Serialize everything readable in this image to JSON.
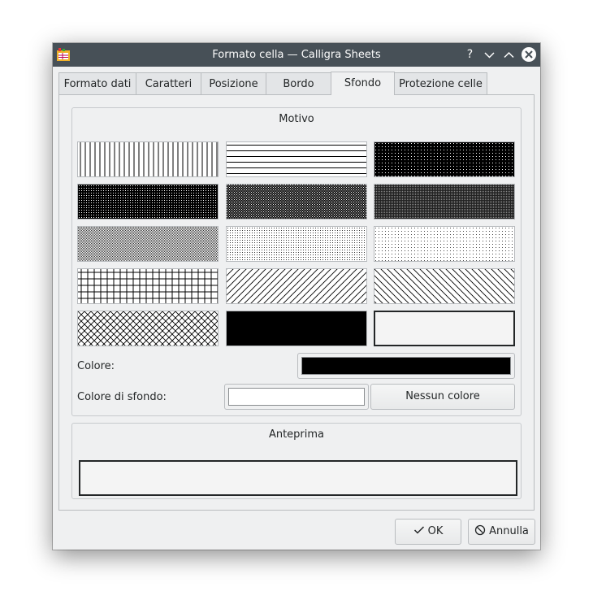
{
  "window": {
    "title": "Formato cella — Calligra Sheets",
    "help_glyph": "?",
    "minimize_glyph": "⌄",
    "maximize_glyph": "⌃",
    "close_glyph": "✕"
  },
  "tabs": [
    {
      "label": "Formato dati"
    },
    {
      "label": "Caratteri"
    },
    {
      "label": "Posizione"
    },
    {
      "label": "Bordo"
    },
    {
      "label": "Sfondo"
    },
    {
      "label": "Protezione celle"
    }
  ],
  "motivo": {
    "title": "Motivo",
    "patterns": [
      "vertical-lines",
      "horizontal-lines",
      "dense-dots-1",
      "dense-dots-2",
      "dense-dots-3",
      "dense-dots-4",
      "dense-dots-5",
      "dense-dots-6",
      "sparse-dots",
      "grid",
      "diagonal-bdiag",
      "diagonal-fdiag",
      "diagonal-cross",
      "solid",
      "no-brush"
    ],
    "color_label": "Colore:",
    "color_value": "#000000",
    "bg_label": "Colore di sfondo:",
    "bg_value": "#ffffff",
    "no_color_label": "Nessun colore"
  },
  "preview": {
    "title": "Anteprima"
  },
  "buttons": {
    "ok_label": "OK",
    "cancel_label": "Annulla"
  },
  "colors": {
    "titlebar": "#475057",
    "window_bg": "#eff0f1"
  }
}
